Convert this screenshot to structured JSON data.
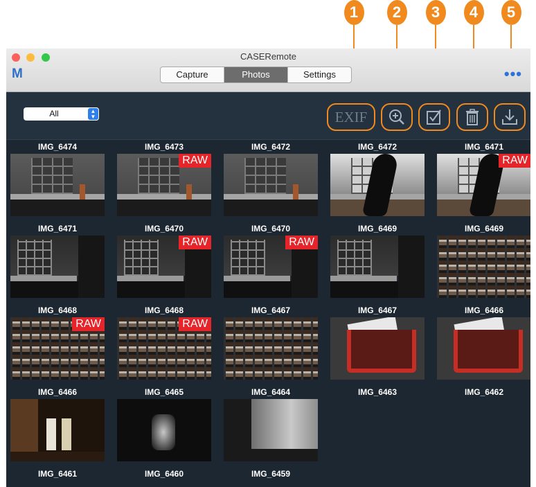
{
  "colors": {
    "accent": "#f08a1e",
    "raw_badge": "#e5252a",
    "window_bg": "#1d2731",
    "link_blue": "#2f73d6"
  },
  "callouts": [
    "1",
    "2",
    "3",
    "4",
    "5"
  ],
  "window": {
    "title": "CASERemote",
    "logo": "M",
    "tabs": [
      "Capture",
      "Photos",
      "Settings"
    ],
    "active_tab": "Photos",
    "more_icon": "ellipsis-icon"
  },
  "toolbar": {
    "filter_value": "All",
    "exif_label": "EXIF",
    "icons": [
      "zoom-in-icon",
      "select-checkbox-icon",
      "trash-icon",
      "download-icon"
    ]
  },
  "photos": [
    {
      "name": "IMG_6474",
      "raw": false,
      "scene": "room"
    },
    {
      "name": "IMG_6473",
      "raw": true,
      "scene": "room"
    },
    {
      "name": "IMG_6472",
      "raw": false,
      "scene": "room"
    },
    {
      "name": "IMG_6472",
      "raw": false,
      "scene": "person"
    },
    {
      "name": "IMG_6471",
      "raw": true,
      "scene": "person"
    },
    {
      "name": "IMG_6471",
      "raw": false,
      "scene": "room-dark"
    },
    {
      "name": "IMG_6470",
      "raw": true,
      "scene": "room-dark"
    },
    {
      "name": "IMG_6470",
      "raw": true,
      "scene": "room-dark"
    },
    {
      "name": "IMG_6469",
      "raw": false,
      "scene": "room-dark"
    },
    {
      "name": "IMG_6469",
      "raw": false,
      "scene": "rack"
    },
    {
      "name": "IMG_6468",
      "raw": true,
      "scene": "rack"
    },
    {
      "name": "IMG_6468",
      "raw": true,
      "scene": "rack"
    },
    {
      "name": "IMG_6467",
      "raw": false,
      "scene": "rack"
    },
    {
      "name": "IMG_6467",
      "raw": false,
      "scene": "cards"
    },
    {
      "name": "IMG_6466",
      "raw": false,
      "scene": "cards"
    },
    {
      "name": "IMG_6466",
      "raw": false,
      "scene": "doorway"
    },
    {
      "name": "IMG_6465",
      "raw": false,
      "scene": "blur-dark"
    },
    {
      "name": "IMG_6464",
      "raw": false,
      "scene": "blur-light"
    }
  ],
  "trailing_labels": [
    "IMG_6463",
    "IMG_6462",
    "IMG_6461",
    "IMG_6460",
    "IMG_6459"
  ],
  "raw_label": "RAW"
}
